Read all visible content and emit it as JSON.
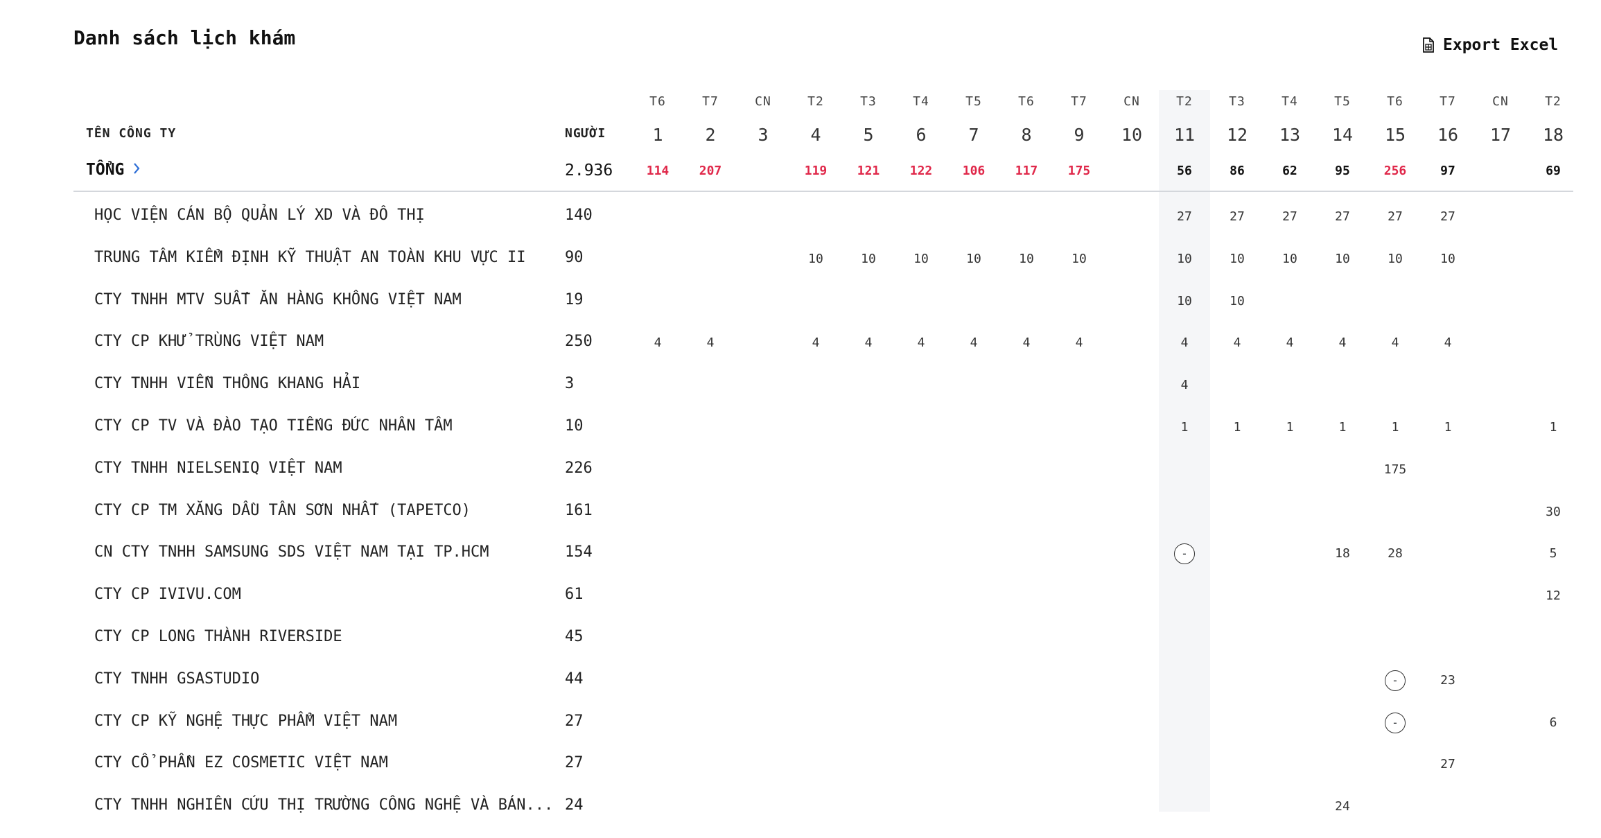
{
  "header": {
    "title": "Danh sách lịch khám",
    "export_label": "Export Excel",
    "export_icon": "spreadsheet-file-icon"
  },
  "table": {
    "company_header": "TÊN CÔNG TY",
    "people_header": "NGƯỜI",
    "today_day_index": 10,
    "days": [
      {
        "dow": "T6",
        "day": "1"
      },
      {
        "dow": "T7",
        "day": "2"
      },
      {
        "dow": "CN",
        "day": "3"
      },
      {
        "dow": "T2",
        "day": "4"
      },
      {
        "dow": "T3",
        "day": "5"
      },
      {
        "dow": "T4",
        "day": "6"
      },
      {
        "dow": "T5",
        "day": "7"
      },
      {
        "dow": "T6",
        "day": "8"
      },
      {
        "dow": "T7",
        "day": "9"
      },
      {
        "dow": "CN",
        "day": "10"
      },
      {
        "dow": "T2",
        "day": "11"
      },
      {
        "dow": "T3",
        "day": "12"
      },
      {
        "dow": "T4",
        "day": "13"
      },
      {
        "dow": "T5",
        "day": "14"
      },
      {
        "dow": "T6",
        "day": "15"
      },
      {
        "dow": "T7",
        "day": "16"
      },
      {
        "dow": "CN",
        "day": "17"
      },
      {
        "dow": "T2",
        "day": "18"
      }
    ],
    "total": {
      "label": "TỔNG",
      "people": "2.936",
      "values": [
        "114",
        "207",
        "",
        "119",
        "121",
        "122",
        "106",
        "117",
        "175",
        "",
        "56",
        "86",
        "62",
        "95",
        "256",
        "97",
        "",
        "69"
      ],
      "over": [
        true,
        true,
        false,
        true,
        true,
        true,
        true,
        true,
        true,
        false,
        false,
        false,
        false,
        false,
        true,
        false,
        false,
        false
      ],
      "over_color": "#e0284a",
      "normal_color": "#111111"
    },
    "rows": [
      {
        "name": "HỌC VIỆN CÁN BỘ QUẢN LÝ XD VÀ ĐÔ THỊ",
        "people": "140",
        "cells": [
          "",
          "",
          "",
          "",
          "",
          "",
          "",
          "",
          "",
          "",
          "27",
          "27",
          "27",
          "27",
          "27",
          "27",
          "",
          ""
        ]
      },
      {
        "name": "TRUNG TÂM KIỂM ĐỊNH KỸ THUẬT AN TOÀN KHU VỰC II",
        "people": "90",
        "cells": [
          "",
          "",
          "",
          "10",
          "10",
          "10",
          "10",
          "10",
          "10",
          "",
          "10",
          "10",
          "10",
          "10",
          "10",
          "10",
          "",
          ""
        ]
      },
      {
        "name": "CTY TNHH MTV SUẤT ĂN HÀNG KHÔNG VIỆT NAM",
        "people": "19",
        "cells": [
          "",
          "",
          "",
          "",
          "",
          "",
          "",
          "",
          "",
          "",
          "10",
          "10",
          "",
          "",
          "",
          "",
          "",
          ""
        ]
      },
      {
        "name": "CTY CP KHỬ TRÙNG VIỆT NAM",
        "people": "250",
        "cells": [
          "4",
          "4",
          "",
          "4",
          "4",
          "4",
          "4",
          "4",
          "4",
          "",
          "4",
          "4",
          "4",
          "4",
          "4",
          "4",
          "",
          ""
        ]
      },
      {
        "name": "CTY TNHH VIỄN THÔNG KHANG HẢI",
        "people": "3",
        "cells": [
          "",
          "",
          "",
          "",
          "",
          "",
          "",
          "",
          "",
          "",
          "4",
          "",
          "",
          "",
          "",
          "",
          "",
          ""
        ]
      },
      {
        "name": "CTY CP TV VÀ ĐÀO TẠO TIẾNG ĐỨC NHÂN TÂM",
        "people": "10",
        "cells": [
          "",
          "",
          "",
          "",
          "",
          "",
          "",
          "",
          "",
          "",
          "1",
          "1",
          "1",
          "1",
          "1",
          "1",
          "",
          "1"
        ]
      },
      {
        "name": "CTY TNHH NIELSENIQ VIỆT NAM",
        "people": "226",
        "cells": [
          "",
          "",
          "",
          "",
          "",
          "",
          "",
          "",
          "",
          "",
          "",
          "",
          "",
          "",
          "175",
          "",
          "",
          ""
        ]
      },
      {
        "name": "CTY CP TM XĂNG DẦU TÂN SƠN NHẤT (TAPETCO)",
        "people": "161",
        "cells": [
          "",
          "",
          "",
          "",
          "",
          "",
          "",
          "",
          "",
          "",
          "",
          "",
          "",
          "",
          "",
          "",
          "",
          "30"
        ]
      },
      {
        "name": "CN CTY TNHH SAMSUNG SDS VIỆT NAM TẠI TP.HCM",
        "people": "154",
        "cells": [
          "",
          "",
          "",
          "",
          "",
          "",
          "",
          "",
          "",
          "",
          "-",
          "",
          "",
          "18",
          "28",
          "",
          "",
          "5"
        ]
      },
      {
        "name": "CTY CP IVIVU.COM",
        "people": "61",
        "cells": [
          "",
          "",
          "",
          "",
          "",
          "",
          "",
          "",
          "",
          "",
          "",
          "",
          "",
          "",
          "",
          "",
          "",
          "12"
        ]
      },
      {
        "name": "CTY CP LONG THÀNH RIVERSIDE",
        "people": "45",
        "cells": [
          "",
          "",
          "",
          "",
          "",
          "",
          "",
          "",
          "",
          "",
          "",
          "",
          "",
          "",
          "",
          "",
          "",
          ""
        ]
      },
      {
        "name": "CTY TNHH GSASTUDIO",
        "people": "44",
        "cells": [
          "",
          "",
          "",
          "",
          "",
          "",
          "",
          "",
          "",
          "",
          "",
          "",
          "",
          "",
          "-",
          "23",
          "",
          ""
        ]
      },
      {
        "name": "CTY CP KỸ NGHỆ THỰC PHẨM VIỆT NAM",
        "people": "27",
        "cells": [
          "",
          "",
          "",
          "",
          "",
          "",
          "",
          "",
          "",
          "",
          "",
          "",
          "",
          "",
          "-",
          "",
          "",
          "6"
        ]
      },
      {
        "name": "CTY CỔ PHẦN EZ COSMETIC VIỆT NAM",
        "people": "27",
        "cells": [
          "",
          "",
          "",
          "",
          "",
          "",
          "",
          "",
          "",
          "",
          "",
          "",
          "",
          "",
          "",
          "27",
          "",
          ""
        ]
      },
      {
        "name": "CTY TNHH NGHIÊN CỨU THỊ TRƯỜNG CÔNG NGHỆ VÀ BÁN...",
        "people": "24",
        "cells": [
          "",
          "",
          "",
          "",
          "",
          "",
          "",
          "",
          "",
          "",
          "",
          "",
          "",
          "24",
          "",
          "",
          "",
          ""
        ]
      }
    ]
  }
}
